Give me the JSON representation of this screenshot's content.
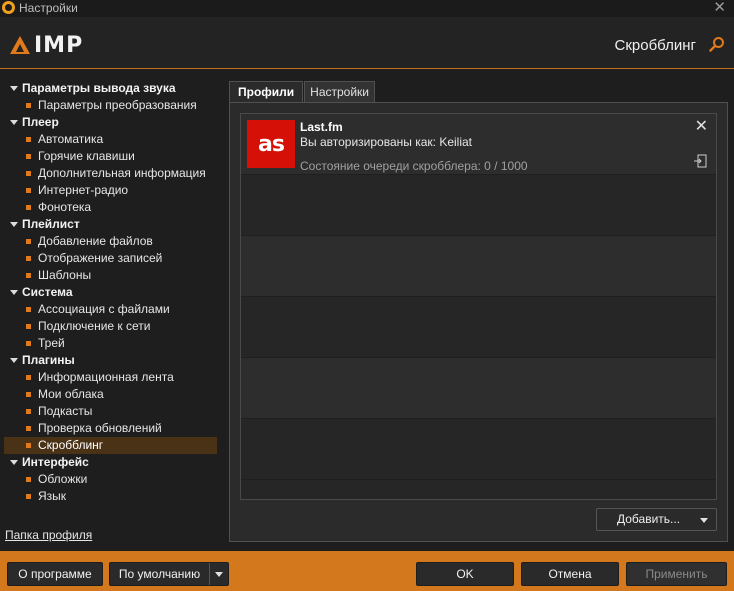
{
  "window": {
    "title": "Настройки",
    "close_glyph": "✕"
  },
  "header": {
    "brand": "IMP",
    "page_title": "Скробблинг",
    "search_icon": "search-icon"
  },
  "sidebar": {
    "groups": [
      {
        "label": "Параметры вывода звука",
        "items": [
          "Параметры преобразования"
        ]
      },
      {
        "label": "Плеер",
        "items": [
          "Автоматика",
          "Горячие клавиши",
          "Дополнительная информация",
          "Интернет-радио",
          "Фонотека"
        ]
      },
      {
        "label": "Плейлист",
        "items": [
          "Добавление файлов",
          "Отображение записей",
          "Шаблоны"
        ]
      },
      {
        "label": "Система",
        "items": [
          "Ассоциация с файлами",
          "Подключение к сети",
          "Трей"
        ]
      },
      {
        "label": "Плагины",
        "items": [
          "Информационная лента",
          "Мои облака",
          "Подкасты",
          "Проверка обновлений",
          "Скробблинг"
        ]
      },
      {
        "label": "Интерфейс",
        "items": [
          "Обложки",
          "Язык"
        ]
      }
    ],
    "selected": "Скробблинг",
    "profile_folder": "Папка профиля"
  },
  "tabs": [
    {
      "label": "Профили",
      "active": true
    },
    {
      "label": "Настройки",
      "active": false
    }
  ],
  "account": {
    "logo_text": "as",
    "service": "Last.fm",
    "user_line": "Вы авторизированы как: Keiliat",
    "queue_line": "Состояние очереди скробблера: 0 / 1000",
    "close_glyph": "✕",
    "logo_color": "#d51007"
  },
  "buttons": {
    "add": "Добавить...",
    "about": "О программе",
    "defaults": "По умолчанию",
    "ok": "OK",
    "cancel": "Отмена",
    "apply": "Применить"
  },
  "colors": {
    "accent": "#d4781e",
    "selected_bg": "#4a3217"
  }
}
